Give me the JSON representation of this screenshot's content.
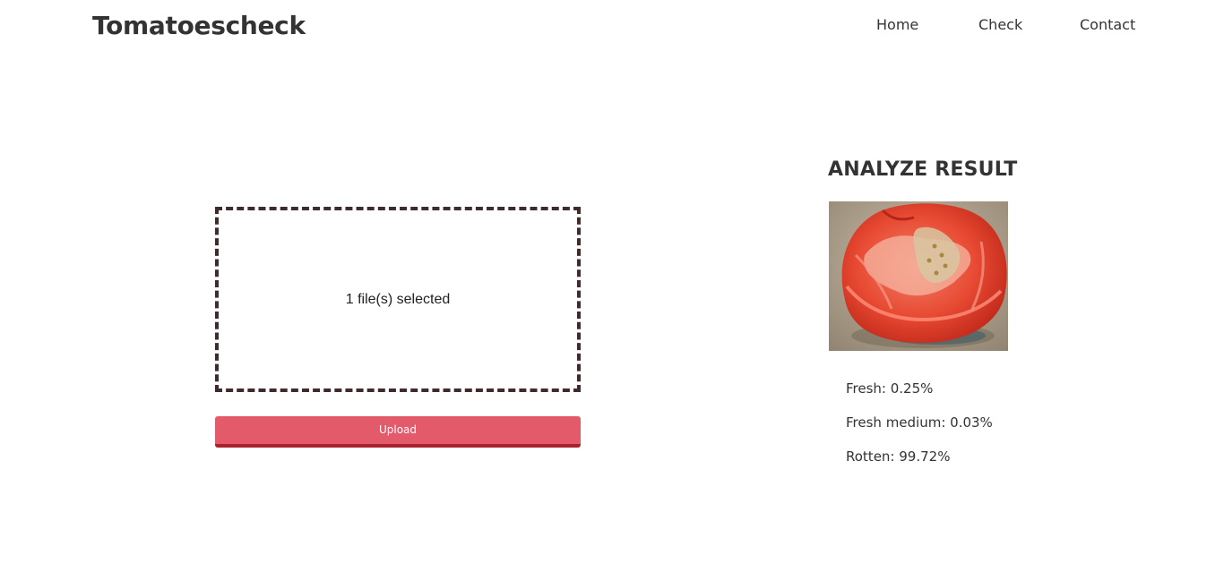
{
  "header": {
    "brand": "Tomatoescheck",
    "nav": {
      "home": "Home",
      "check": "Check",
      "contact": "Contact"
    }
  },
  "upload": {
    "dropzone_text": "1 file(s) selected",
    "button_label": "Upload"
  },
  "result": {
    "title": "ANALYZE RESULT",
    "image_icon": "rotten-tomato-photo",
    "items": [
      {
        "label": "Fresh: 0.25%"
      },
      {
        "label": "Fresh medium: 0.03%"
      },
      {
        "label": "Rotten: 99.72%"
      }
    ]
  },
  "colors": {
    "text": "#333333",
    "accent_button": "#e35a6a",
    "button_shadow": "#a8232f",
    "dropzone_border": "#3f2a2c"
  }
}
